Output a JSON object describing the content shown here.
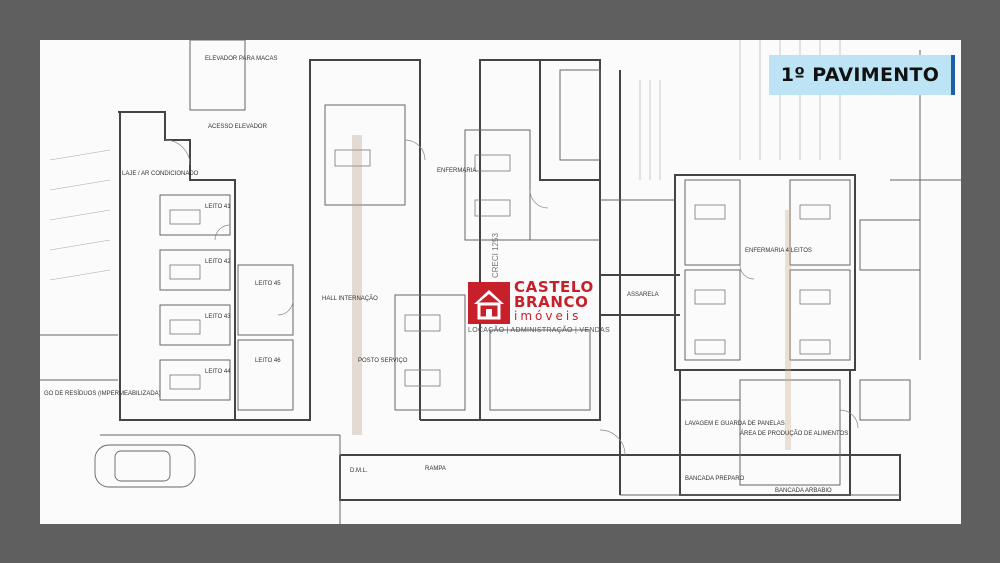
{
  "badge": {
    "text": "1º PAVIMENTO"
  },
  "logo": {
    "line1": "CASTELO",
    "line2": "BRANCO",
    "line3": "imóveis",
    "tagline": "LOCAÇÃO | ADMINISTRAÇÃO | VENDAS",
    "creci": "CRECI 1253",
    "color": "#c8202b"
  },
  "plan_labels": {
    "acesso_elevador": "ACESSO ELEVADOR",
    "laje_ar": "LAJE / AR CONDICIONADO",
    "hall_internacao": "HALL INTERNAÇÃO",
    "posto_servico": "POSTO SERVIÇO",
    "enfermaria": "ENFERMARIA",
    "assarela": "ASSARELA",
    "area_producao": "ÁREA DE PRODUÇÃO DE ALIMENTOS",
    "bancada_prepar": "BANCADA PREPARO",
    "bancada_abrabio": "BANCADA ARBABIO",
    "residuos": "GO DE RESÍDUOS (IMPERMEABILIZADA)",
    "rampa": "RAMPA",
    "dml": "D.M.L.",
    "leito_41": "LEITO 41",
    "leito_42": "LEITO 42",
    "leito_43": "LEITO 43",
    "leito_44": "LEITO 44",
    "leito_45": "LEITO 45",
    "leito_46": "LEITO 46",
    "elevador": "ELEVADOR PARA MACAS",
    "lavagem": "LAVAGEM E GUARDA DE PANELAS",
    "enfermaria_leitos": "ENFERMARIA 4 LEITOS"
  }
}
